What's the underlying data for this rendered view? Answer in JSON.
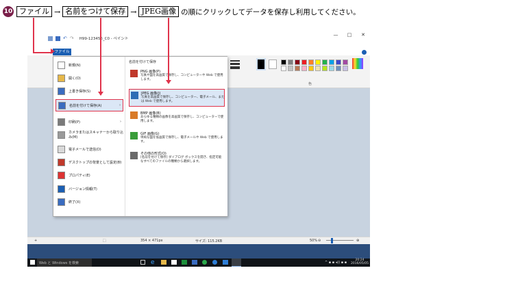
{
  "instruction": {
    "step_number": "10",
    "step1": "ファイル",
    "step2": "名前をつけて保存",
    "step3": "JPEG画像",
    "arrow": "→",
    "text": "の順にクリックしてデータを保存し利用してください。"
  },
  "window": {
    "title": "H99-123456_C0 - ペイント",
    "controls": [
      "—",
      "□",
      "✕"
    ]
  },
  "ribbon": {
    "file_tab": "ファイル",
    "group_label": "色",
    "size_label": "線の幅",
    "color1": "色\n1",
    "color2": "色\n2",
    "edit_colors": "色の\n編集",
    "palette": [
      "#000000",
      "#7f7f7f",
      "#880015",
      "#ed1c24",
      "#ff7f27",
      "#fff200",
      "#22b14c",
      "#00a2e8",
      "#3f48cc",
      "#a349a4",
      "#ffffff",
      "#c3c3c3",
      "#b97a57",
      "#ffaec9",
      "#ffc90e",
      "#efe4b0",
      "#b5e61d",
      "#99d9ea",
      "#7092be",
      "#c8bfe7"
    ]
  },
  "file_menu": {
    "items": [
      {
        "label": "新規(N)",
        "icon": "new-file-icon",
        "color": "#ffffff"
      },
      {
        "label": "開く(O)",
        "icon": "open-folder-icon",
        "color": "#e6b84a"
      },
      {
        "label": "上書き保存(S)",
        "icon": "save-icon",
        "color": "#3a6cc0"
      },
      {
        "label": "名前を付けて保存(A)",
        "icon": "save-as-icon",
        "color": "#3a6cc0",
        "has_submenu": true,
        "highlighted": true
      },
      {
        "label": "印刷(P)",
        "icon": "printer-icon",
        "color": "#7a7a7a",
        "has_submenu": true
      },
      {
        "label": "カメラまたはスキャナーから取り込み(M)",
        "icon": "scanner-icon",
        "color": "#9a9a9a"
      },
      {
        "label": "電子メールで送信(D)",
        "icon": "email-icon",
        "color": "#d9d9d9"
      },
      {
        "label": "デスクトップの背景として設定(B)",
        "icon": "desktop-icon",
        "color": "#c0392b",
        "has_submenu": true
      },
      {
        "label": "プロパティ(E)",
        "icon": "check-icon",
        "color": "#d33"
      },
      {
        "label": "バージョン情報(T)",
        "icon": "info-icon",
        "color": "#1b5fb3"
      },
      {
        "label": "終了(X)",
        "icon": "exit-icon",
        "color": "#3a6cc0"
      }
    ],
    "submenu": {
      "heading": "名前を付けて保存",
      "items": [
        {
          "name": "PNG 画像(P)",
          "desc": "写真や図を高画質で保存し、コンピューターや Web で使用します。",
          "icon": "png-icon",
          "color": "#c0392b"
        },
        {
          "name": "JPEG 画像(J)",
          "desc": "写真を高画質で保存し、コンピューター、電子メール、または Web で使用します。",
          "icon": "jpeg-icon",
          "color": "#2e6db5",
          "highlighted": true
        },
        {
          "name": "BMP 画像(B)",
          "desc": "あらゆる種類の画像を高画質で保存し、コンピューターで使用します。",
          "icon": "bmp-icon",
          "color": "#d97b29"
        },
        {
          "name": "GIF 画像(G)",
          "desc": "単純な図を低画質で保存し、電子メールや Web で使用します。",
          "icon": "gif-icon",
          "color": "#3a9d3a"
        },
        {
          "name": "その他の形式(O)",
          "desc": "[名前を付けて保存] ダイアログ ボックスを開き、指定可能なすべてのファイルの種類から選択します。",
          "icon": "other-format-icon",
          "color": "#6a6a6a"
        }
      ]
    }
  },
  "status_bar": {
    "add": "+",
    "select_icon": "⬚",
    "position": "354 × 471px",
    "size": "サイズ: 115.2KB",
    "zoom": "50%",
    "zoom_minus": "⊖",
    "zoom_plus": "⊕"
  },
  "taskbar": {
    "search": "Web と Windows を検索",
    "time": "20:24",
    "date": "2016/05/05"
  }
}
